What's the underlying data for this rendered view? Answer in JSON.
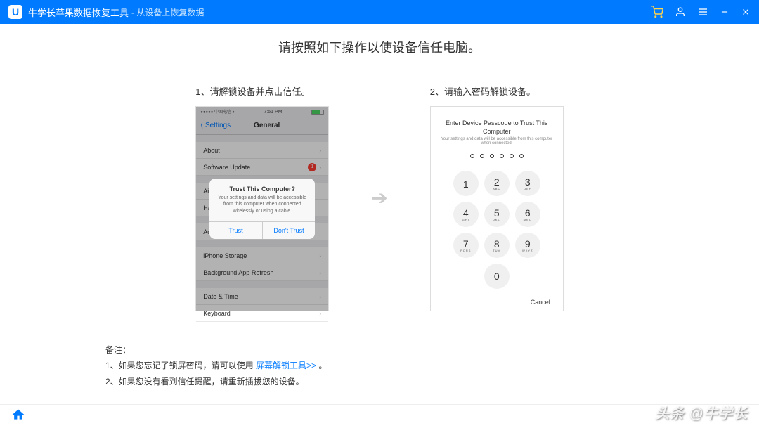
{
  "titlebar": {
    "logo_letter": "U",
    "title": "牛学长苹果数据恢复工具",
    "subtitle": " - 从设备上恢复数据"
  },
  "page": {
    "heading": "请按照如下操作以使设备信任电脑。"
  },
  "step1": {
    "title": "1、请解锁设备并点击信任。",
    "status": {
      "carrier": "●●●●● 中国电信 ⏵",
      "time": "7:51 PM"
    },
    "nav": {
      "back": "⟨ Settings",
      "title": "General"
    },
    "rows": {
      "about": "About",
      "software_update": "Software Update",
      "airdrop": "AirDr",
      "handoff": "Hand",
      "accessibility": "Acce",
      "iphone_storage": "iPhone Storage",
      "background_refresh": "Background App Refresh",
      "date_time": "Date & Time",
      "keyboard": "Keyboard"
    },
    "alert": {
      "title": "Trust This Computer?",
      "message": "Your settings and data will be accessible from this computer when connected wirelessly or using a cable.",
      "trust": "Trust",
      "dont_trust": "Don't Trust"
    }
  },
  "step2": {
    "title": "2、请输入密码解锁设备。",
    "pc_title": "Enter Device Passcode to Trust This Computer",
    "pc_sub": "Your settings and data will be accessible from this computer when connected.",
    "keys": [
      {
        "n": "1",
        "s": " "
      },
      {
        "n": "2",
        "s": "ABC"
      },
      {
        "n": "3",
        "s": "DEF"
      },
      {
        "n": "4",
        "s": "GHI"
      },
      {
        "n": "5",
        "s": "JKL"
      },
      {
        "n": "6",
        "s": "MNO"
      },
      {
        "n": "7",
        "s": "PQRS"
      },
      {
        "n": "8",
        "s": "TUV"
      },
      {
        "n": "9",
        "s": "WXYZ"
      }
    ],
    "zero": "0",
    "cancel": "Cancel"
  },
  "notes": {
    "label": "备注：",
    "line1_pre": "1、如果您忘记了锁屏密码，请可以使用 ",
    "line1_link": "屏幕解锁工具>>",
    "line1_post": " 。",
    "line2": "2、如果您没有看到信任提醒，请重新插拔您的设备。"
  },
  "watermark": "头条 @牛学长"
}
